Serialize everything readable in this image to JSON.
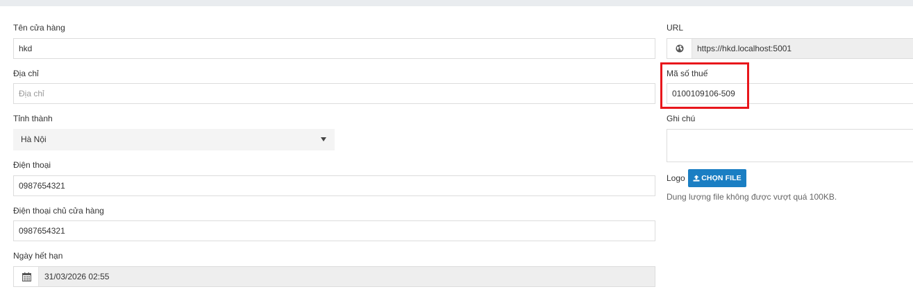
{
  "left": {
    "store_name": {
      "label": "Tên cửa hàng",
      "value": "hkd"
    },
    "address": {
      "label": "Địa chỉ",
      "placeholder": "Địa chỉ"
    },
    "province": {
      "label": "Tỉnh thành",
      "value": "Hà Nội"
    },
    "phone": {
      "label": "Điện thoại",
      "value": "0987654321"
    },
    "owner_phone": {
      "label": "Điện thoại chủ cửa hàng",
      "value": "0987654321"
    },
    "expiry": {
      "label": "Ngày hết hạn",
      "value": "31/03/2026 02:55"
    }
  },
  "right": {
    "url": {
      "label": "URL",
      "value": "https://hkd.localhost:5001"
    },
    "tax_code": {
      "label": "Mã số thuế",
      "value": "0100109106-509"
    },
    "note": {
      "label": "Ghi chú",
      "value": ""
    },
    "logo": {
      "label": "Logo",
      "button_label": "CHỌN FILE",
      "hint": "Dung lượng file không được vượt quá 100KB."
    }
  },
  "colors": {
    "highlight": "#e8161b",
    "button": "#1a7ec3"
  },
  "icons": {
    "url_addon": "globe-icon",
    "expiry_addon": "calendar-icon",
    "province_caret": "caret-down-icon",
    "upload": "upload-icon"
  }
}
